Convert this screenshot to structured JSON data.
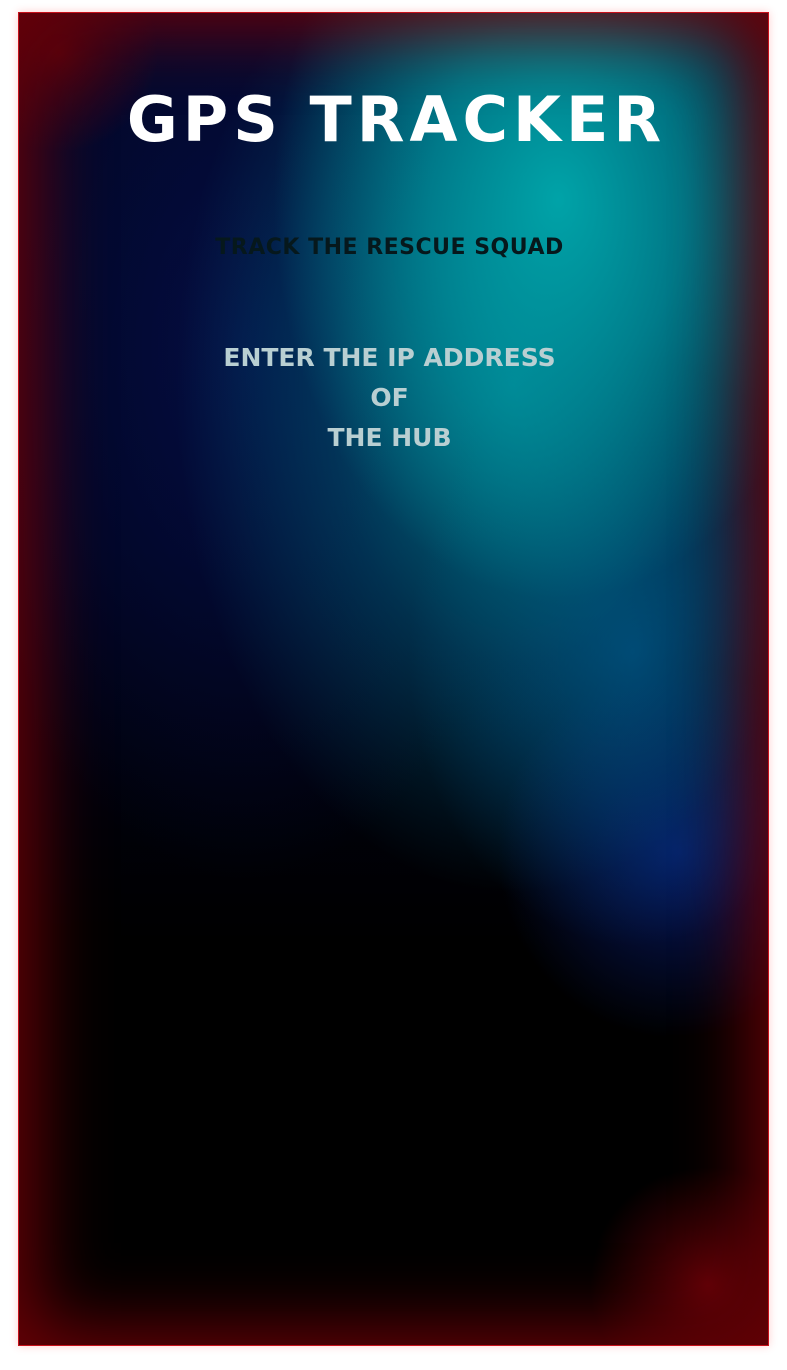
{
  "app": {
    "title": "GPS TRACKER",
    "subtitle": "TRACK THE RESCUE SQUAD",
    "prompt_lines": [
      "ENTER THE IP ADDRESS",
      "OF",
      "THE HUB"
    ]
  },
  "colors": {
    "title": "#ffffff",
    "subtitle": "#06181c",
    "prompt": "#b9cfd2",
    "border": "#c8101a",
    "glow_teal": "#00a8ac",
    "glow_blue": "#081e78",
    "vignette_red": "#6e0006"
  }
}
